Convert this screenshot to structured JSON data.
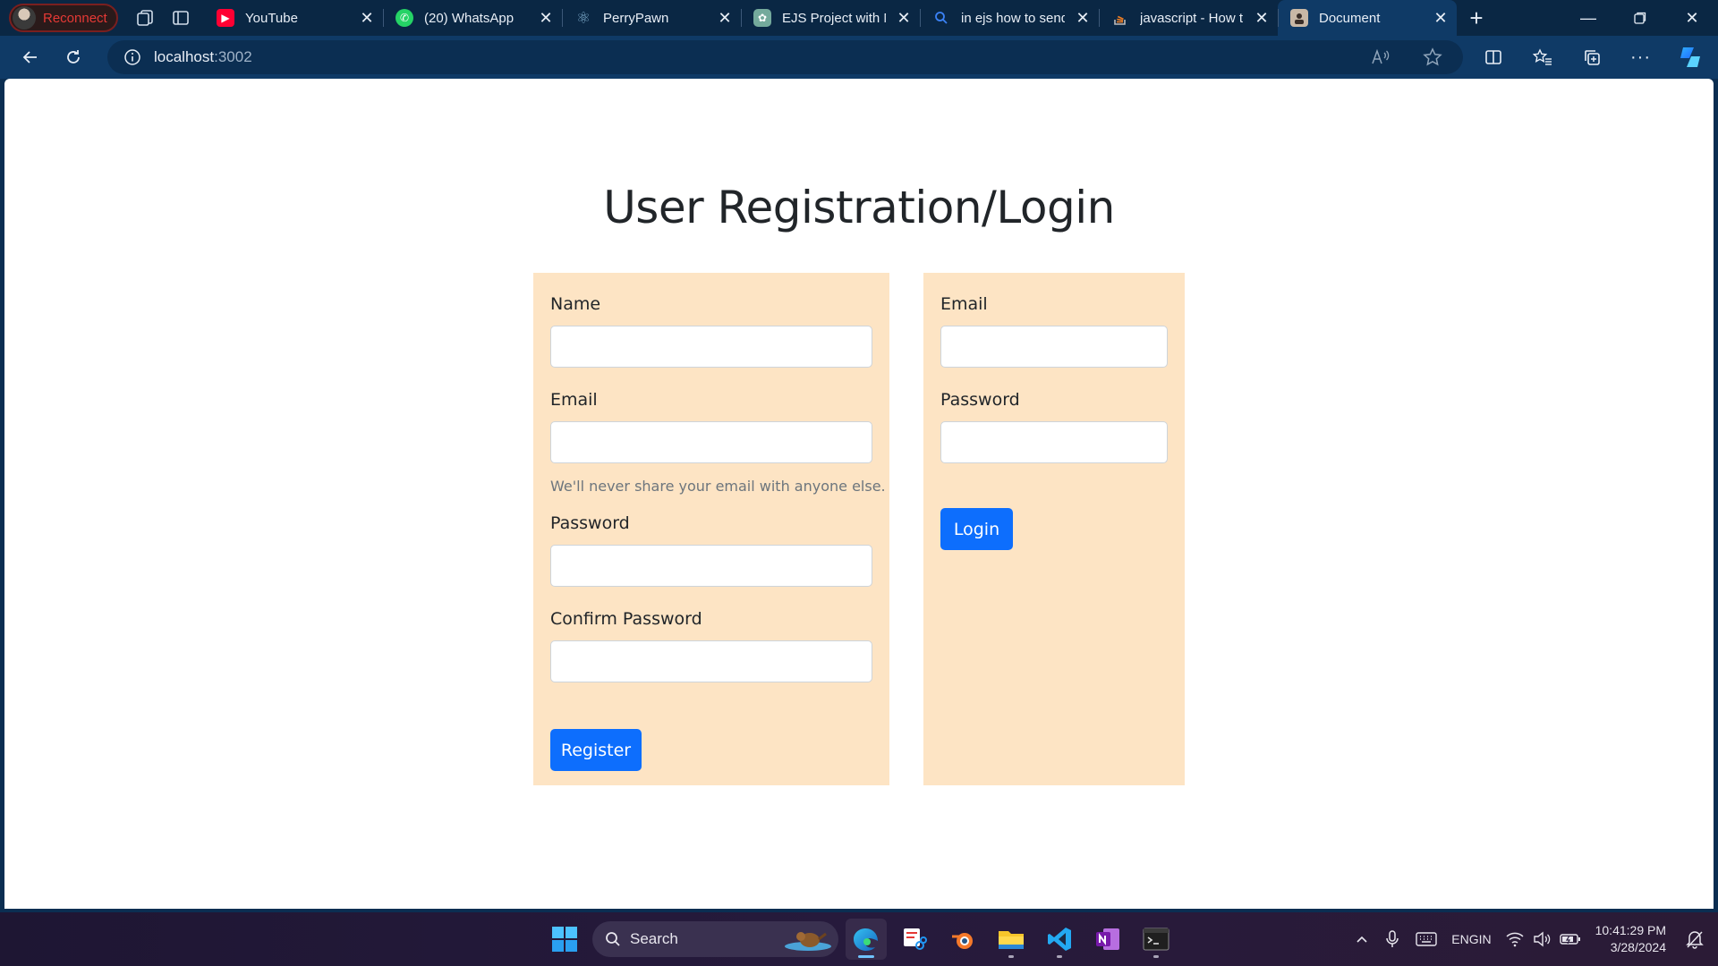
{
  "browser": {
    "profile_label": "Reconnect",
    "tabs": [
      {
        "title": "YouTube",
        "icon": "youtube-icon",
        "color": "#ff0033",
        "active": false
      },
      {
        "title": "(20) WhatsApp",
        "icon": "whatsapp-icon",
        "color": "#25d366",
        "active": false
      },
      {
        "title": "PerryPawn",
        "icon": "react-icon",
        "color": "#7aa7c7",
        "active": false
      },
      {
        "title": "EJS Project with M",
        "icon": "chatgpt-icon",
        "color": "#74aa9c",
        "active": false
      },
      {
        "title": "in ejs how to send",
        "icon": "search-icon",
        "color": "#3b82f6",
        "active": false
      },
      {
        "title": "javascript - How t",
        "icon": "stackoverflow-icon",
        "color": "#f48024",
        "active": false
      },
      {
        "title": "Document",
        "icon": "document-icon",
        "color": "#c9b8a6",
        "active": true
      }
    ],
    "address": {
      "host": "localhost",
      "port": ":3002"
    }
  },
  "page": {
    "title": "User Registration/Login",
    "register": {
      "name_label": "Name",
      "email_label": "Email",
      "email_help": "We'll never share your email with anyone else.",
      "password_label": "Password",
      "confirm_label": "Confirm Password",
      "button_label": "Register"
    },
    "login": {
      "email_label": "Email",
      "password_label": "Password",
      "button_label": "Login"
    },
    "colors": {
      "card_bg": "#fde4c4",
      "primary": "#0d6efd"
    }
  },
  "taskbar": {
    "search_label": "Search",
    "apps": [
      "windows-start-icon",
      "edge-icon",
      "snipping-tool-icon",
      "blender-icon",
      "file-explorer-icon",
      "vscode-icon",
      "onenote-icon",
      "terminal-icon"
    ],
    "language": "ENG",
    "region": "IN",
    "time": "10:41:29 PM",
    "date": "3/28/2024"
  }
}
